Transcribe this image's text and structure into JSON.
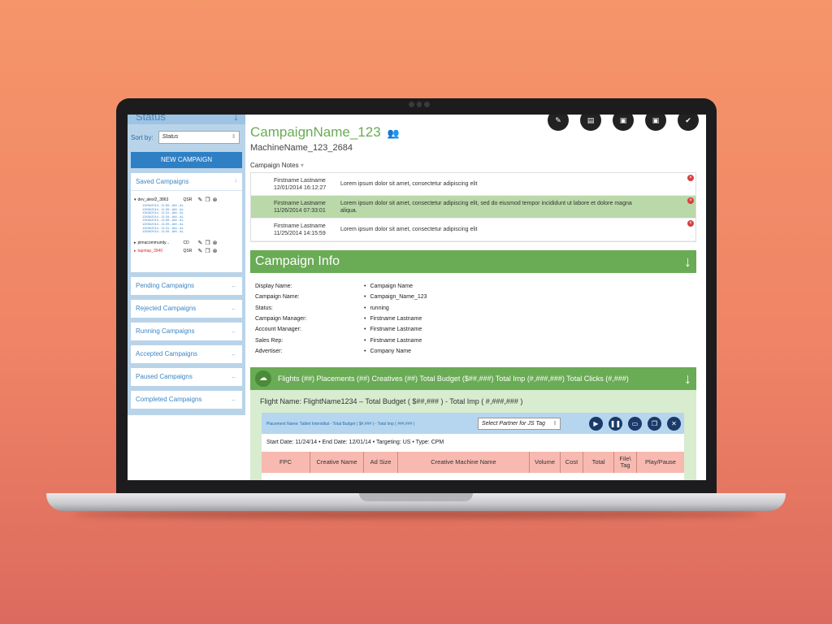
{
  "sidebar": {
    "header": "Status",
    "sort_label": "Sort by:",
    "sort_value": "Status",
    "new_campaign": "NEW CAMPAIGN",
    "saved_title": "Saved Campaigns",
    "campaigns": [
      {
        "name": "dev_alexl2_3863",
        "type": "QSR",
        "expanded": true,
        "sub": [
          "13/06/2014 - 11:55 - AM - AL",
          "13/06/2014 - 11:39 - AM - AL",
          "13/06/2014 - 11:31 - AM - AL",
          "13/06/2014 - 11:26 - AM - AL",
          "13/06/2014 - 11:55 - AM - AL",
          "13/06/2014 - 11:39 - AM - AL",
          "13/06/2014 - 11:31 - AM - AL",
          "13/06/2014 - 11:26 - AM - AL"
        ]
      },
      {
        "name": "pimacommunity...",
        "type": "CD",
        "expanded": false,
        "sub": []
      },
      {
        "name": "tapntap_3940",
        "type": "QSR",
        "expanded": false,
        "sub": []
      }
    ],
    "nav": [
      "Pending Campaigns",
      "Rejected Campaigns",
      "Running Campaigns",
      "Accepted Campaigns",
      "Paused Campaigns",
      "Completed Campaigns"
    ]
  },
  "main": {
    "campaign_name": "CampaignName_123",
    "machine_name": "MachineName_123_2684",
    "notes_label": "Campaign Notes",
    "notes": [
      {
        "who": "Firstname Lastname",
        "when": "12/01/2014 16:12:27",
        "text": "Lorem ipsum dolor sit amet, consectetur adipiscing elit",
        "highlight": false
      },
      {
        "who": "Firstname Lastname",
        "when": "11/26/2014 07:33:01",
        "text": "Lorem ipsum dolor sit amet, consectetur adipiscing elit, sed do eiusmod tempor incididunt ut labore et dolore magna aliqua.",
        "highlight": true
      },
      {
        "who": "Firstname Lastname",
        "when": "11/25/2014 14:15:59",
        "text": "Lorem ipsum dolor sit amet, consectetur adipiscing elit",
        "highlight": false
      }
    ],
    "info_title": "Campaign Info",
    "info": [
      {
        "k": "Display Name:",
        "v": "Campaign Name"
      },
      {
        "k": "Campaign Name:",
        "v": "Campaign_Name_123"
      },
      {
        "k": "Status:",
        "v": "running"
      },
      {
        "k": "Campaign Manager:",
        "v": "Firstname Lastname"
      },
      {
        "k": "Account Manager:",
        "v": "Firstname Lastname"
      },
      {
        "k": "Sales Rep:",
        "v": "Firstname Lastname"
      },
      {
        "k": "Advertiser:",
        "v": "Company Name"
      }
    ],
    "flights_bar": "Flights (##) Placements (##) Creatives (##) Total Budget ($##,###) Total Imp (#,###,###) Total Clicks (#,###)",
    "flight_name": "Flight Name: FlightName1234 – Total Budget ( $##,### ) - Total Imp ( #,###,### )",
    "placement_name": "Placement Name: Tablet Interstitial - Total Budget ( $#,### ) - Total Imp ( ###,### )",
    "partner_select": "Select Partner for JS Tag",
    "dates": "Start Date: 11/24/14  •  End Date: 12/01/14  •  Targeting: US  •  Type: CPM",
    "columns": [
      "FPC",
      "Creative Name",
      "Ad Size",
      "Creative Machine Name",
      "Volume",
      "Cost",
      "Total",
      "File\\ Tag",
      "Play/Pause"
    ]
  }
}
